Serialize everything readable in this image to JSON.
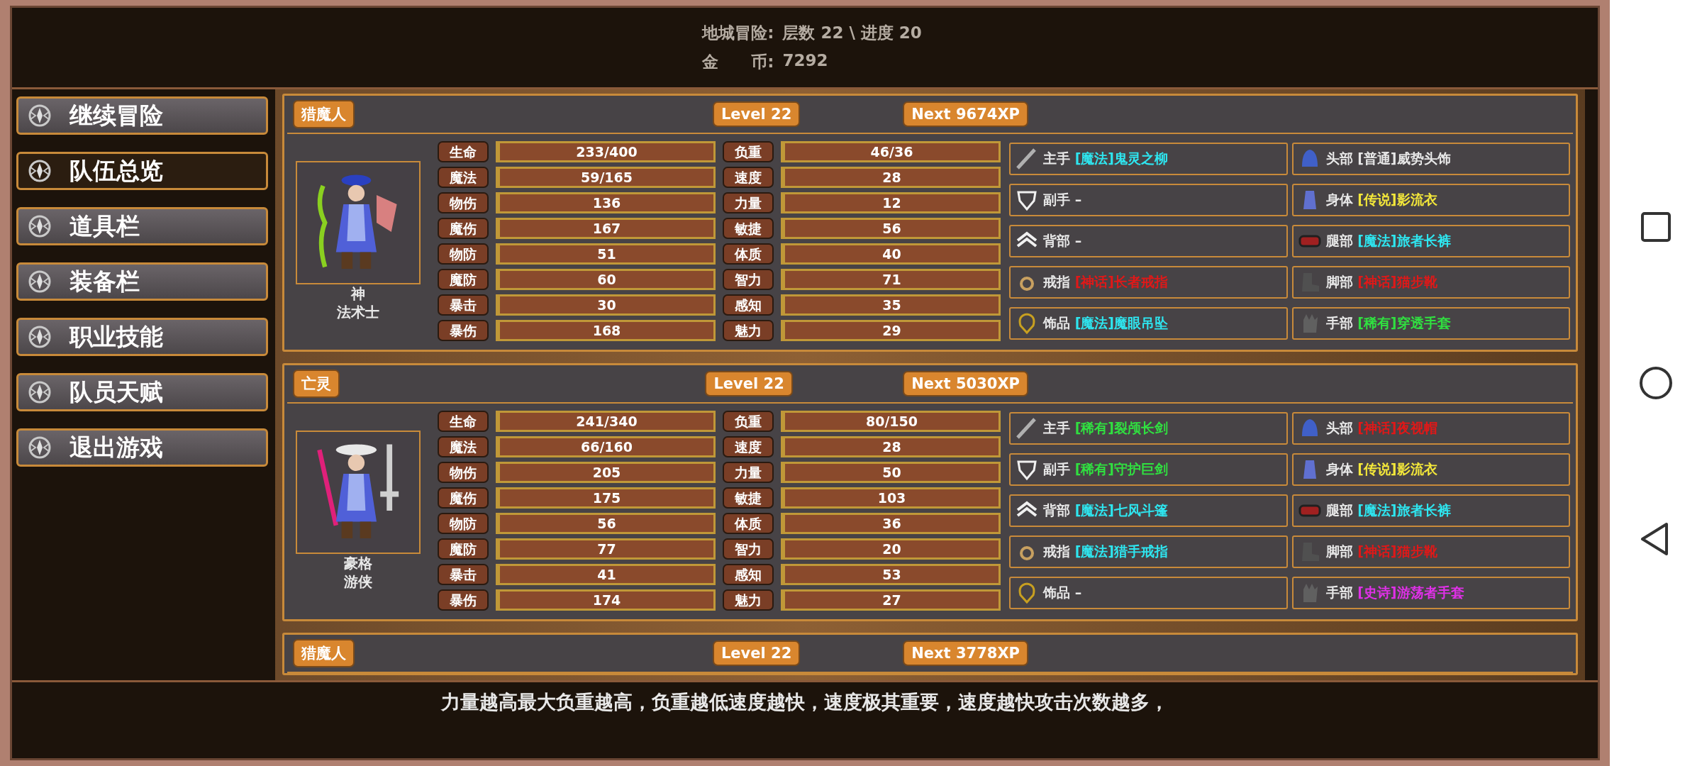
{
  "header": {
    "lines": [
      {
        "label": "地城冒险:",
        "value": "层数 22 \\ 进度 20"
      },
      {
        "label": "金　　币:",
        "value": "7292"
      }
    ]
  },
  "sidebar": {
    "items": [
      {
        "label": "继续冒险",
        "selected": false
      },
      {
        "label": "队伍总览",
        "selected": true
      },
      {
        "label": "道具栏",
        "selected": false
      },
      {
        "label": "装备栏",
        "selected": false
      },
      {
        "label": "职业技能",
        "selected": false
      },
      {
        "label": "队员天赋",
        "selected": false
      },
      {
        "label": "退出游戏",
        "selected": false
      }
    ]
  },
  "characters": [
    {
      "tag": "猎魔人",
      "level": "Level 22",
      "next": "Next 9674XP",
      "name": "神",
      "class": "法术士",
      "stats": [
        {
          "label": "生命",
          "value": "233/400"
        },
        {
          "label": "负重",
          "value": "46/36"
        },
        {
          "label": "魔法",
          "value": "59/165"
        },
        {
          "label": "速度",
          "value": "28"
        },
        {
          "label": "物伤",
          "value": "136"
        },
        {
          "label": "力量",
          "value": "12"
        },
        {
          "label": "魔伤",
          "value": "167"
        },
        {
          "label": "敏捷",
          "value": "56"
        },
        {
          "label": "物防",
          "value": "51"
        },
        {
          "label": "体质",
          "value": "40"
        },
        {
          "label": "魔防",
          "value": "60"
        },
        {
          "label": "智力",
          "value": "71"
        },
        {
          "label": "暴击",
          "value": "30"
        },
        {
          "label": "感知",
          "value": "35"
        },
        {
          "label": "暴伤",
          "value": "168"
        },
        {
          "label": "魅力",
          "value": "29"
        }
      ],
      "equipment": [
        {
          "slot": "主手",
          "rarity": "[魔法]",
          "name": "鬼灵之柳",
          "kind": "magic"
        },
        {
          "slot": "头部",
          "rarity": "[普通]",
          "name": "威势头饰",
          "kind": "common"
        },
        {
          "slot": "副手",
          "name": "–",
          "kind": "empty"
        },
        {
          "slot": "身体",
          "rarity": "[传说]",
          "name": "影流衣",
          "kind": "legendary"
        },
        {
          "slot": "背部",
          "name": "–",
          "kind": "empty"
        },
        {
          "slot": "腿部",
          "rarity": "[魔法]",
          "name": "旅者长裤",
          "kind": "magic"
        },
        {
          "slot": "戒指",
          "rarity": "[神话]",
          "name": "长者戒指",
          "kind": "mythic"
        },
        {
          "slot": "脚部",
          "rarity": "[神话]",
          "name": "猫步靴",
          "kind": "mythic"
        },
        {
          "slot": "饰品",
          "rarity": "[魔法]",
          "name": "魔眼吊坠",
          "kind": "magic"
        },
        {
          "slot": "手部",
          "rarity": "[稀有]",
          "name": "穿透手套",
          "kind": "rare"
        }
      ]
    },
    {
      "tag": "亡灵",
      "level": "Level 22",
      "next": "Next 5030XP",
      "name": "豪格",
      "class": "游侠",
      "stats": [
        {
          "label": "生命",
          "value": "241/340"
        },
        {
          "label": "负重",
          "value": "80/150"
        },
        {
          "label": "魔法",
          "value": "66/160"
        },
        {
          "label": "速度",
          "value": "28"
        },
        {
          "label": "物伤",
          "value": "205"
        },
        {
          "label": "力量",
          "value": "50"
        },
        {
          "label": "魔伤",
          "value": "175"
        },
        {
          "label": "敏捷",
          "value": "103"
        },
        {
          "label": "物防",
          "value": "56"
        },
        {
          "label": "体质",
          "value": "36"
        },
        {
          "label": "魔防",
          "value": "77"
        },
        {
          "label": "智力",
          "value": "20"
        },
        {
          "label": "暴击",
          "value": "41"
        },
        {
          "label": "感知",
          "value": "53"
        },
        {
          "label": "暴伤",
          "value": "174"
        },
        {
          "label": "魅力",
          "value": "27"
        }
      ],
      "equipment": [
        {
          "slot": "主手",
          "rarity": "[稀有]",
          "name": "裂颅长剑",
          "kind": "rare"
        },
        {
          "slot": "头部",
          "rarity": "[神话]",
          "name": "夜视帽",
          "kind": "mythic"
        },
        {
          "slot": "副手",
          "rarity": "[稀有]",
          "name": "守护巨剑",
          "kind": "rare"
        },
        {
          "slot": "身体",
          "rarity": "[传说]",
          "name": "影流衣",
          "kind": "legendary"
        },
        {
          "slot": "背部",
          "rarity": "[魔法]",
          "name": "七风斗篷",
          "kind": "magic"
        },
        {
          "slot": "腿部",
          "rarity": "[魔法]",
          "name": "旅者长裤",
          "kind": "magic"
        },
        {
          "slot": "戒指",
          "rarity": "[魔法]",
          "name": "猎手戒指",
          "kind": "magic"
        },
        {
          "slot": "脚部",
          "rarity": "[神话]",
          "name": "猫步靴",
          "kind": "mythic"
        },
        {
          "slot": "饰品",
          "name": "–",
          "kind": "empty"
        },
        {
          "slot": "手部",
          "rarity": "[史诗]",
          "name": "游荡者手套",
          "kind": "epic"
        }
      ]
    },
    {
      "tag": "猎魔人",
      "level": "Level 22",
      "next": "Next 3778XP"
    }
  ],
  "hint": "力量越高最大负重越高，负重越低速度越快，速度极其重要，速度越快攻击次数越多，"
}
